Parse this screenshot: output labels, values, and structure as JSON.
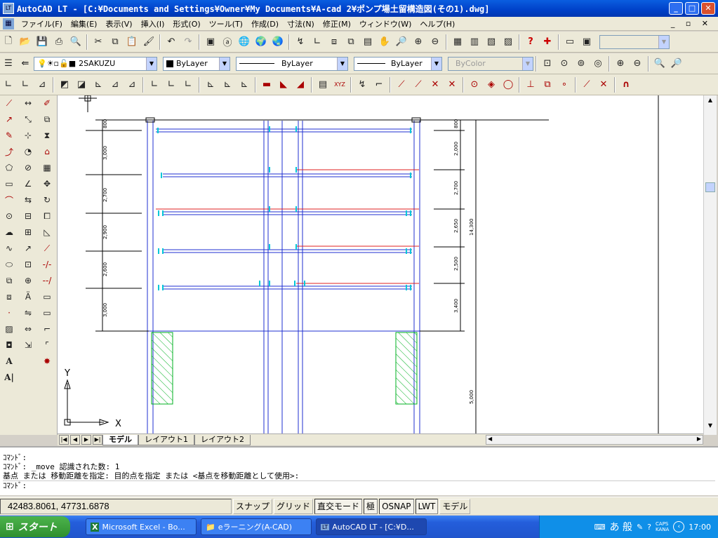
{
  "window": {
    "title": "AutoCAD LT - [C:¥Documents and Settings¥Owner¥My Documents¥A-cad 2¥ポンプ場土留構造図(その1).dwg]",
    "app_icon": "LT"
  },
  "menu": {
    "items": [
      "ファイル(F)",
      "編集(E)",
      "表示(V)",
      "挿入(I)",
      "形式(O)",
      "ツール(T)",
      "作成(D)",
      "寸法(N)",
      "修正(M)",
      "ウィンドウ(W)",
      "ヘルプ(H)"
    ]
  },
  "layers": {
    "current_layer": "2SAKUZU",
    "color": "ByLayer",
    "linetype": "ByLayer",
    "lineweight": "ByLayer",
    "plotstyle": "ByColor"
  },
  "drawing": {
    "ucs_x": "X",
    "ucs_y": "Y",
    "left_dims": [
      "800",
      "3,000",
      "2,700",
      "2,900",
      "2,600",
      "3,000"
    ],
    "right_dims": [
      "800",
      "2,000",
      "2,700",
      "2,650",
      "2,500",
      "3,400",
      "14,300",
      "5,000"
    ],
    "colors": {
      "blue": "#1f2fd0",
      "red": "#e02020",
      "cyan": "#00c8d8",
      "green": "#00b020",
      "black": "#000000"
    }
  },
  "tabs": [
    "モデル",
    "レイアウト1",
    "レイアウト2"
  ],
  "command_lines": [
    "ｺﾏﾝﾄﾞ:",
    "ｺﾏﾝﾄﾞ: _move 認識された数: 1",
    "基点 または 移動距離を指定: 目的点を指定 または <基点を移動距離として使用>:",
    "ｺﾏﾝﾄﾞ:"
  ],
  "status": {
    "coords": "42483.8061, 47731.6878",
    "buttons": [
      "スナップ",
      "グリッド",
      "直交モード",
      "極",
      "OSNAP",
      "LWT",
      "モデル"
    ]
  },
  "taskbar": {
    "start": "スタート",
    "tasks": [
      "Microsoft Excel - Bo...",
      "eラーニング(A-CAD)",
      "AutoCAD LT - [C:¥D..."
    ],
    "tray_caps": "CAPS",
    "tray_kana": "KANA",
    "tray_ime": "あ 般",
    "clock": "17:00"
  }
}
